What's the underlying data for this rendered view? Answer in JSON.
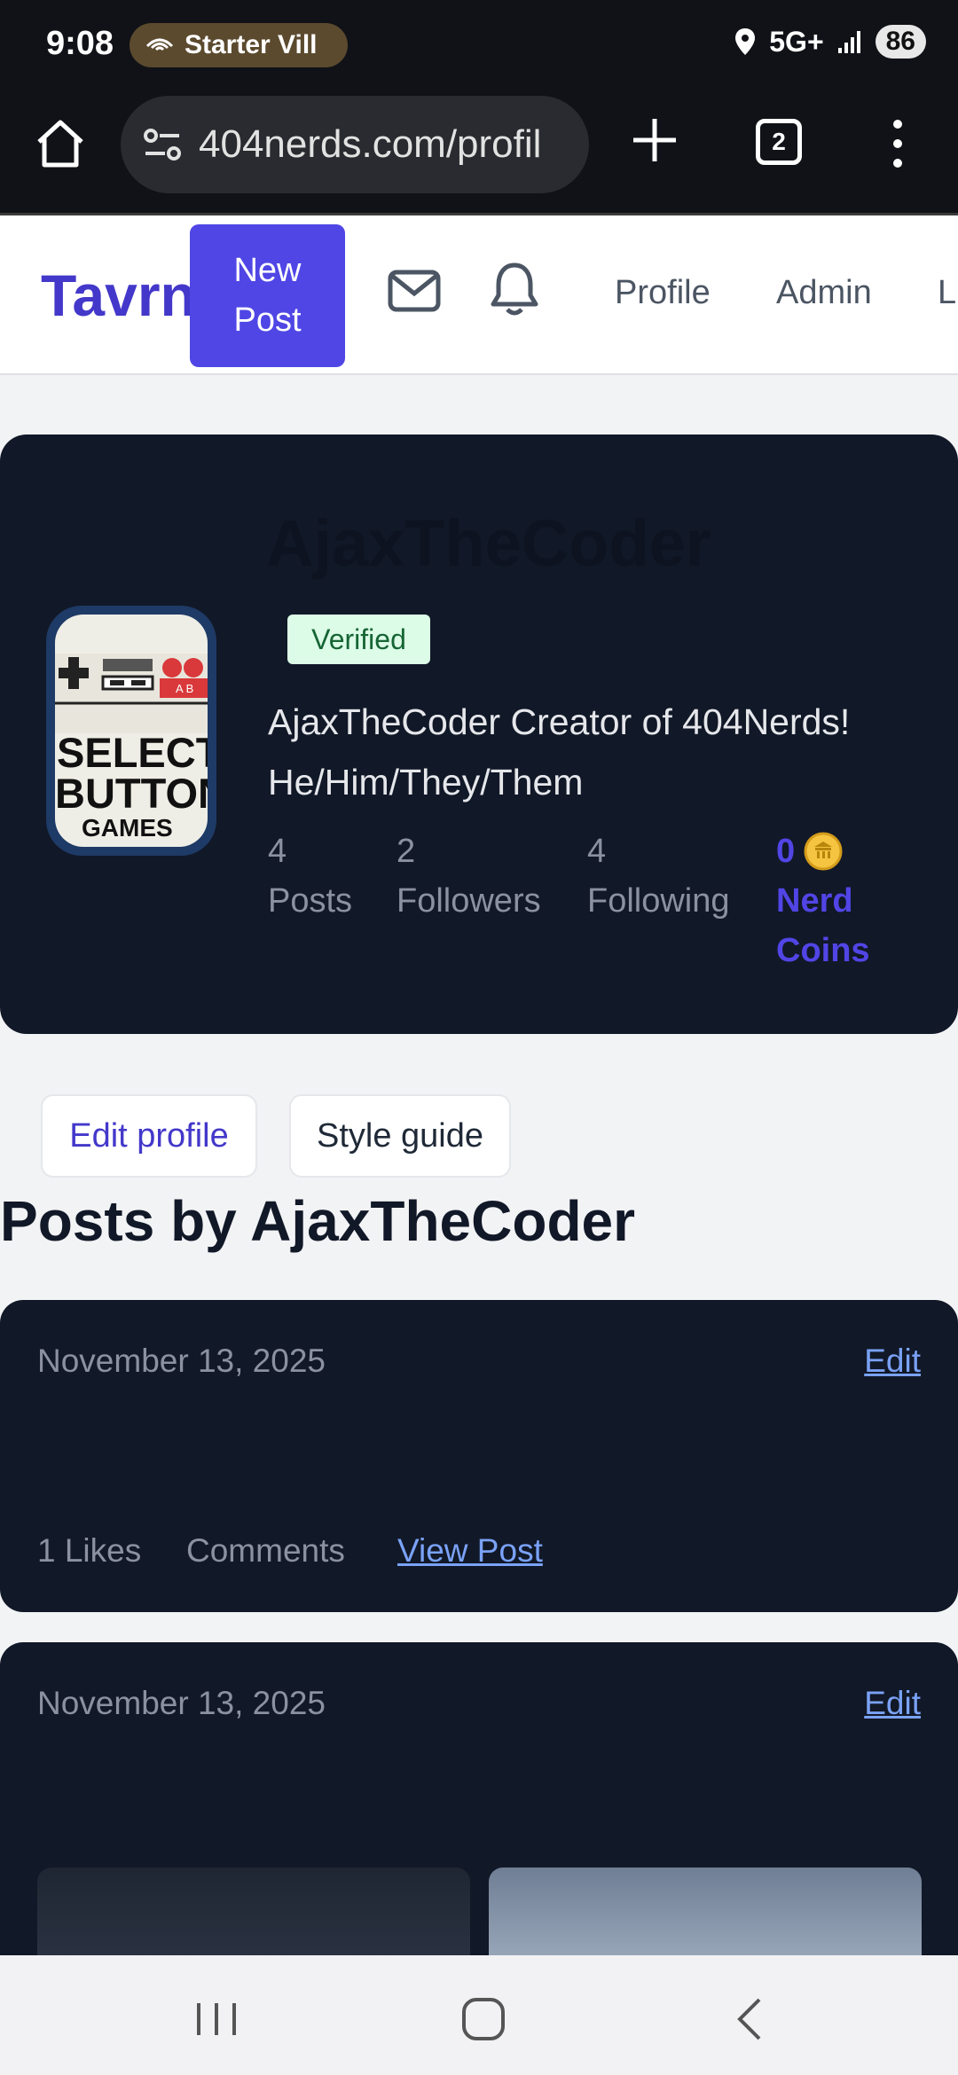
{
  "status_bar": {
    "time": "9:08",
    "pill_text": "Starter Vill",
    "network": "5G+",
    "battery": "86"
  },
  "browser": {
    "url": "404nerds.com/profil",
    "tab_count": "2"
  },
  "nav": {
    "brand": "Tavrn",
    "new_post_line1": "New",
    "new_post_line2": "Post",
    "links": [
      "Profile",
      "Admin",
      "L"
    ]
  },
  "profile": {
    "title": "AjaxTheCoder",
    "badge": "Verified",
    "bio_line1": "AjaxTheCoder Creator of 404Nerds!",
    "bio_line2": "He/Him/They/Them",
    "avatar_text": [
      "SELECT",
      "BUTTON",
      "GAMES"
    ],
    "stats": {
      "posts_count": "4",
      "posts_label": "Posts",
      "followers_count": "2",
      "followers_label": "Followers",
      "following_count": "4",
      "following_label": "Following",
      "coins_count": "0",
      "coins_label_1": "Nerd",
      "coins_label_2": "Coins"
    }
  },
  "actions": {
    "edit_profile": "Edit profile",
    "style_guide": "Style guide"
  },
  "posts_heading": "Posts by AjaxTheCoder",
  "posts": [
    {
      "date": "November 13, 2025",
      "edit": "Edit",
      "likes": "1 Likes",
      "comments": "Comments",
      "view": "View Post"
    },
    {
      "date": "November 13, 2025",
      "edit": "Edit"
    }
  ],
  "colors": {
    "brand": "#4338ca",
    "primary_button": "#4f46e5",
    "card_bg": "#111827",
    "link": "#7aa2f7",
    "verified_bg": "#dcfce7"
  }
}
